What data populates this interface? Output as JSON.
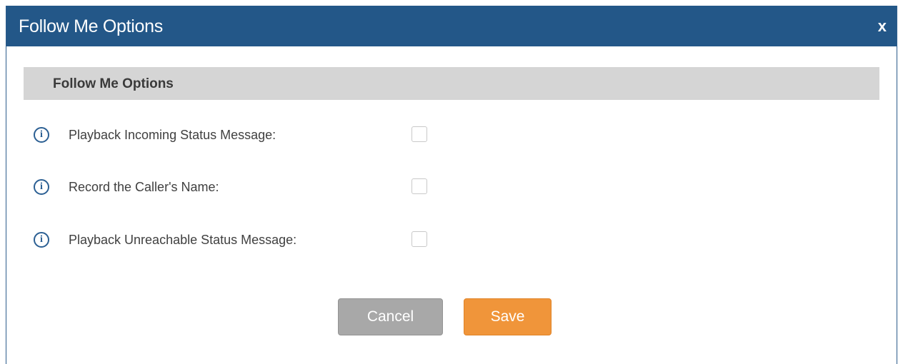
{
  "dialog": {
    "title": "Follow Me Options",
    "close_label": "x"
  },
  "section": {
    "header": "Follow Me Options"
  },
  "options": [
    {
      "label": "Playback Incoming Status Message:",
      "checked": false
    },
    {
      "label": "Record the Caller's Name:",
      "checked": false
    },
    {
      "label": "Playback Unreachable Status Message:",
      "checked": false
    }
  ],
  "info_icon_glyph": "i",
  "buttons": {
    "cancel_label": "Cancel",
    "save_label": "Save"
  },
  "colors": {
    "titlebar": "#235788",
    "section_header_bg": "#d5d5d5",
    "cancel_bg": "#a8a8a8",
    "save_bg": "#f0953a",
    "info_icon": "#2b5f93"
  }
}
